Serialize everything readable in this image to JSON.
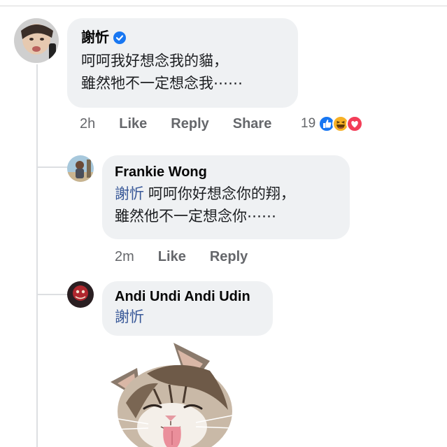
{
  "comments": [
    {
      "author": "謝忻",
      "verified": true,
      "lines": [
        "呵呵我好想念我的貓，",
        "雖然牠不一定想念我⋯⋯"
      ],
      "time": "2h",
      "like_label": "Like",
      "reply_label": "Reply",
      "share_label": "Share",
      "reaction_count": "19",
      "reaction_icons": [
        "like-reaction-icon",
        "haha-reaction-icon",
        "love-reaction-icon"
      ]
    },
    {
      "author": "Frankie Wong",
      "mention": "謝忻",
      "line1_rest": " 呵呵你好想念你的翔，",
      "line2": "雖然他不一定想念你⋯⋯",
      "time": "2m",
      "like_label": "Like",
      "reply_label": "Reply"
    },
    {
      "author": "Andi Undi Andi Udin",
      "mention": "謝忻",
      "sticker": "licking-cat-sticker"
    }
  ],
  "colors": {
    "bubble": "#eff1f3",
    "meta_text": "#65676b",
    "mention": "#385898",
    "verified": "#1877f2",
    "like_blue": "#1877f2",
    "love_red": "#f33e58",
    "haha_yellow": "#f7b125"
  }
}
